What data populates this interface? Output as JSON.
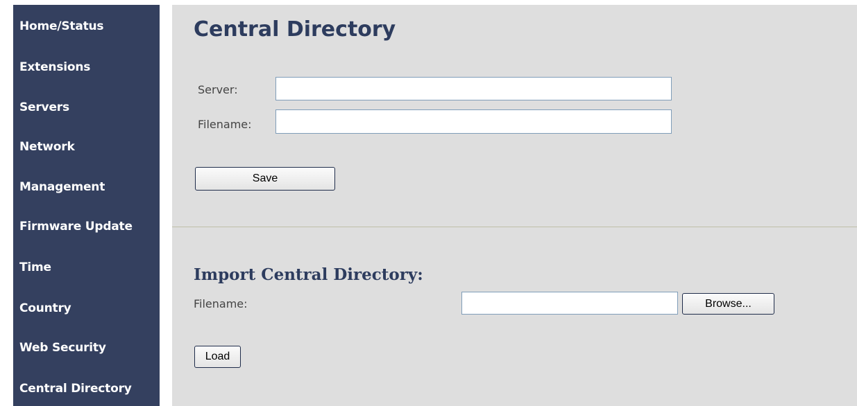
{
  "sidebar": {
    "items": [
      {
        "label": "Home/Status"
      },
      {
        "label": "Extensions"
      },
      {
        "label": "Servers"
      },
      {
        "label": "Network"
      },
      {
        "label": "Management"
      },
      {
        "label": "Firmware Update"
      },
      {
        "label": "Time"
      },
      {
        "label": "Country"
      },
      {
        "label": "Web Security"
      },
      {
        "label": "Central Directory"
      }
    ]
  },
  "main": {
    "title": "Central Directory",
    "server_label": "Server:",
    "server_value": "",
    "filename_label": "Filename:",
    "filename_value": "",
    "save_label": "Save"
  },
  "import": {
    "title": "Import Central Directory:",
    "filename_label": "Filename:",
    "file_value": "",
    "browse_label": "Browse...",
    "load_label": "Load"
  },
  "colors": {
    "sidebar_bg": "#34405f",
    "content_bg": "#dedede",
    "title_color": "#2d3c5e"
  }
}
